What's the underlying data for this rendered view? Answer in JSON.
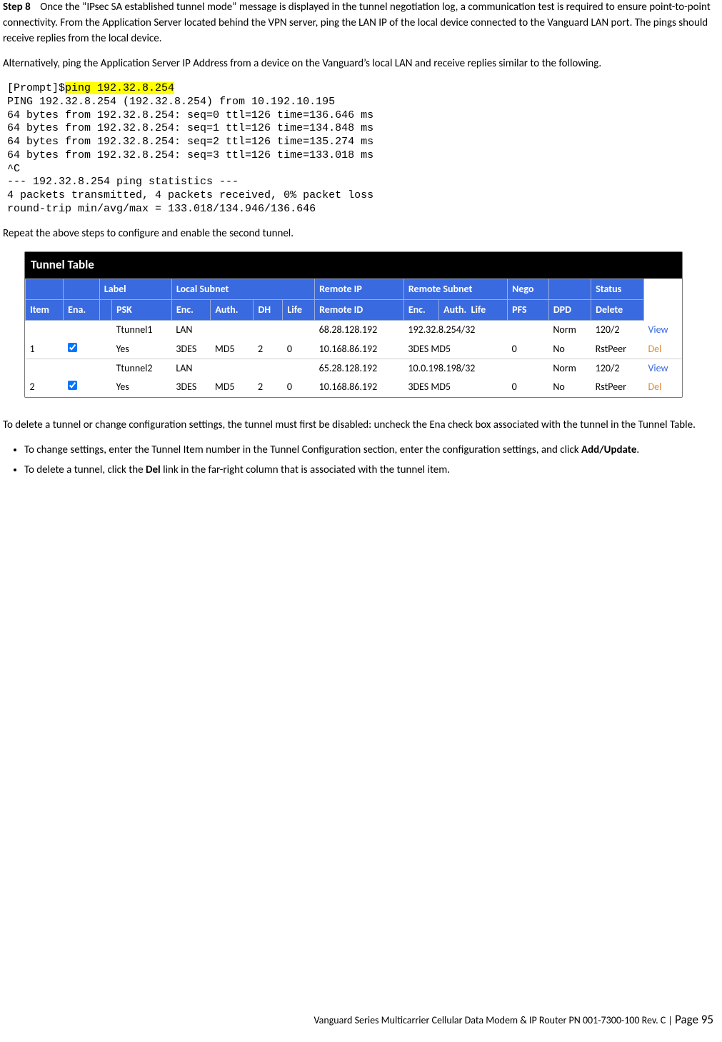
{
  "step": {
    "label": "Step 8",
    "text": "Once the “IPsec SA established tunnel mode” message is displayed in the tunnel negotiation log, a communication test is required to ensure point-to-point connectivity. From the Application Server located behind the VPN server, ping the LAN IP of the local device connected to the Vanguard  LAN port. The pings should receive replies from the local device."
  },
  "alt_text": "Alternatively, ping the Application Server IP Address from a device on the Vanguard’s local LAN and receive replies similar to the following.",
  "terminal": {
    "prompt": "[Prompt]$",
    "cmd": "ping 192.32.8.254",
    "lines": [
      "PING 192.32.8.254 (192.32.8.254) from 10.192.10.195",
      "64 bytes from 192.32.8.254: seq=0 ttl=126 time=136.646 ms",
      "64 bytes from 192.32.8.254: seq=1 ttl=126 time=134.848 ms",
      "64 bytes from 192.32.8.254: seq=2 ttl=126 time=135.274 ms",
      "64 bytes from 192.32.8.254: seq=3 ttl=126 time=133.018 ms",
      "^C",
      "--- 192.32.8.254 ping statistics ---",
      "4 packets transmitted, 4 packets received, 0% packet loss",
      "round-trip min/avg/max = 133.018/134.946/136.646"
    ]
  },
  "repeat_text": "Repeat the above steps to configure and enable the second tunnel.",
  "table": {
    "title": "Tunnel Table",
    "head_top": {
      "item": "",
      "ena": "",
      "label": "Label",
      "localsubnet": "Local Subnet",
      "remoteip": "Remote IP",
      "remotesubnet": "Remote Subnet",
      "nego": "Nego",
      "dpd_blank": "",
      "status": "Status"
    },
    "head_bot": {
      "item": "Item",
      "ena": "Ena.",
      "psk_blank": "",
      "psk": "PSK",
      "enc": "Enc.",
      "auth": "Auth.",
      "dh": "DH",
      "life": "Life",
      "remoteid": "Remote ID",
      "enc2": "Enc.",
      "auth2": "Auth.",
      "life2": "Life",
      "pfs": "PFS",
      "dpd": "DPD",
      "delete": "Delete"
    },
    "rows": [
      {
        "item": "",
        "ena_blank": "",
        "psk_blank": "",
        "label": "Ttunnel1",
        "ls": "LAN",
        "auth": "",
        "dh": "",
        "life": "",
        "rip": "68.28.128.192",
        "rs": "192.32.8.254/32",
        "life2": "",
        "nego": "Norm",
        "dpd": "120/2",
        "act": "View",
        "act_class": "view-link"
      },
      {
        "item": "1",
        "ena_chk": true,
        "psk_blank": "",
        "label": "Yes",
        "ls": "3DES",
        "auth": "MD5",
        "dh": "2",
        "life": "0",
        "rip": "10.168.86.192",
        "rs": "3DES  MD5",
        "life2": "0",
        "nego": "No",
        "dpd": "RstPeer",
        "act": "Del",
        "act_class": "del-link"
      },
      {
        "item": "",
        "ena_blank": "",
        "psk_blank": "",
        "label": "Ttunnel2",
        "ls": "LAN",
        "auth": "",
        "dh": "",
        "life": "",
        "rip": "65.28.128.192",
        "rs": "10.0.198.198/32",
        "life2": "",
        "nego": "Norm",
        "dpd": "120/2",
        "act": "View",
        "act_class": "view-link"
      },
      {
        "item": "2",
        "ena_chk": true,
        "psk_blank": "",
        "label": "Yes",
        "ls": "3DES",
        "auth": "MD5",
        "dh": "2",
        "life": "0",
        "rip": "10.168.86.192",
        "rs": "3DES  MD5",
        "life2": "0",
        "nego": "No",
        "dpd": "RstPeer",
        "act": "Del",
        "act_class": "del-link"
      }
    ]
  },
  "delete_intro": "To delete a tunnel or change configuration settings, the tunnel must first be disabled: uncheck the Ena check box associated with the tunnel in the Tunnel Table.",
  "bullets": {
    "b1_pre": "To change settings, enter the Tunnel Item number in the Tunnel Configuration section, enter the configuration settings, and click ",
    "b1_bold": "Add/Update",
    "b1_post": ".",
    "b2_pre": "To delete a tunnel, click the ",
    "b2_bold": "Del",
    "b2_post": " link in the far-right column that is associated with the tunnel item."
  },
  "footer": {
    "title": "Vanguard Series Multicarrier Cellular Data Modem & IP Router PN 001-7300-100 Rev. C",
    "sep": " | ",
    "page_label": "Page 95"
  }
}
